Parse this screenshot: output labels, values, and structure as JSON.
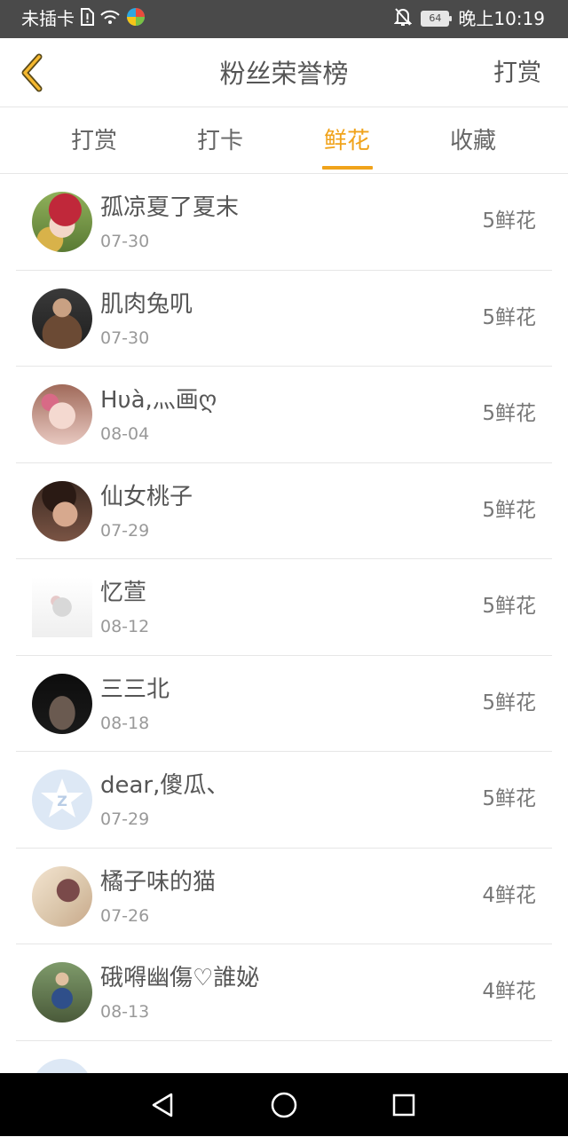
{
  "status_bar": {
    "carrier": "未插卡",
    "battery": "64",
    "time": "晚上10:19",
    "icons": [
      "sim-alert-icon",
      "wifi-icon",
      "app-logo-icon",
      "bell-off-icon",
      "battery-icon"
    ]
  },
  "header": {
    "title": "粉丝荣誉榜",
    "action_label": "打赏",
    "back_icon": "chevron-left-icon"
  },
  "tabs": [
    {
      "label": "打赏",
      "active": false
    },
    {
      "label": "打卡",
      "active": false
    },
    {
      "label": "鲜花",
      "active": true
    },
    {
      "label": "收藏",
      "active": false
    }
  ],
  "fans": [
    {
      "name": "孤凉夏了夏末",
      "date": "07-30",
      "count": "5鲜花"
    },
    {
      "name": "肌肉兔叽",
      "date": "07-30",
      "count": "5鲜花"
    },
    {
      "name": "Hυà,灬画ღ",
      "date": "08-04",
      "count": "5鲜花"
    },
    {
      "name": "仙女桃子",
      "date": "07-29",
      "count": "5鲜花"
    },
    {
      "name": "忆萱",
      "date": "08-12",
      "count": "5鲜花"
    },
    {
      "name": "三三北",
      "date": "08-18",
      "count": "5鲜花"
    },
    {
      "name": "dear,傻瓜、",
      "date": "07-29",
      "count": "5鲜花"
    },
    {
      "name": "橘子味的猫",
      "date": "07-26",
      "count": "4鲜花"
    },
    {
      "name": "硪嘚幽傷♡誰妼",
      "date": "08-13",
      "count": "4鲜花"
    }
  ],
  "colors": {
    "accent": "#f0a31b",
    "status_bar": "#4a4a4a",
    "system_nav": "#000000",
    "text_primary": "#555555",
    "text_secondary": "#999999"
  },
  "system_nav": {
    "icons": [
      "back-triangle-icon",
      "home-circle-icon",
      "recents-square-icon"
    ]
  }
}
